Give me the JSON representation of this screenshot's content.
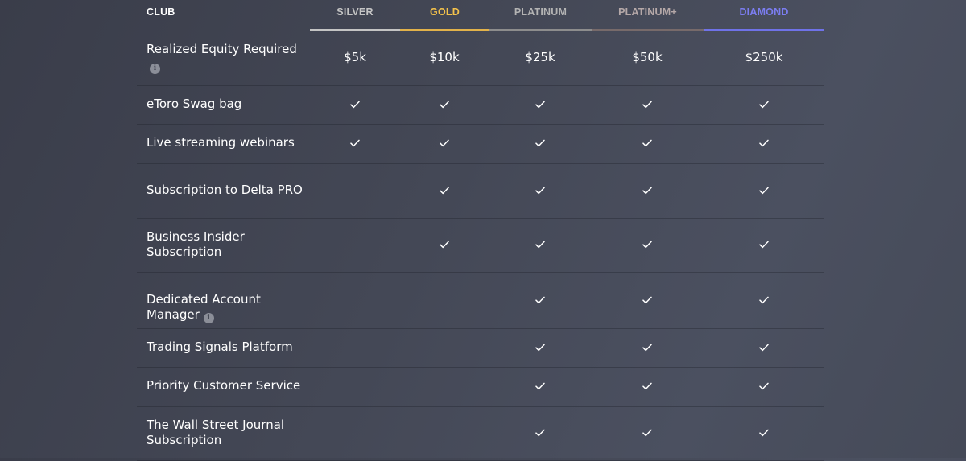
{
  "header": {
    "club_label": "CLUB",
    "tiers": [
      {
        "name": "SILVER",
        "color": "#c4c4c4",
        "underline": "#c4c4c4"
      },
      {
        "name": "GOLD",
        "color": "#f2c14b",
        "underline": "#e2b24a"
      },
      {
        "name": "PLATINUM",
        "color": "#b3b3b3",
        "underline": "#8d8d8d"
      },
      {
        "name": "PLATINUM+",
        "color": "#b5a8a8",
        "underline": "#776a6a"
      },
      {
        "name": "DIAMOND",
        "color": "#7b7df0",
        "underline": "#6f72e8"
      }
    ]
  },
  "rows": [
    {
      "feature": "Realized Equity Required",
      "info_icon": "info-icon",
      "info_inline": false,
      "values": [
        "$5k",
        "$10k",
        "$25k",
        "$50k",
        "$250k"
      ]
    },
    {
      "feature": "eToro Swag bag",
      "values": [
        true,
        true,
        true,
        true,
        true
      ]
    },
    {
      "feature": "Live streaming webinars",
      "values": [
        true,
        true,
        true,
        true,
        true
      ]
    },
    {
      "feature": "Subscription to Delta PRO",
      "values": [
        false,
        true,
        true,
        true,
        true
      ]
    },
    {
      "feature": "Business Insider Subscription",
      "values": [
        false,
        true,
        true,
        true,
        true
      ]
    },
    {
      "feature": "Dedicated Account Manager",
      "info_icon": "info-icon",
      "info_inline": true,
      "values": [
        false,
        false,
        true,
        true,
        true
      ]
    },
    {
      "feature": "Trading Signals Platform",
      "values": [
        false,
        false,
        true,
        true,
        true
      ]
    },
    {
      "feature": "Priority Customer Service",
      "values": [
        false,
        false,
        true,
        true,
        true
      ]
    },
    {
      "feature": "The Wall Street Journal Subscription",
      "values": [
        false,
        false,
        true,
        true,
        true
      ]
    }
  ],
  "icons": {
    "check": "check-icon",
    "info": "info-icon"
  }
}
